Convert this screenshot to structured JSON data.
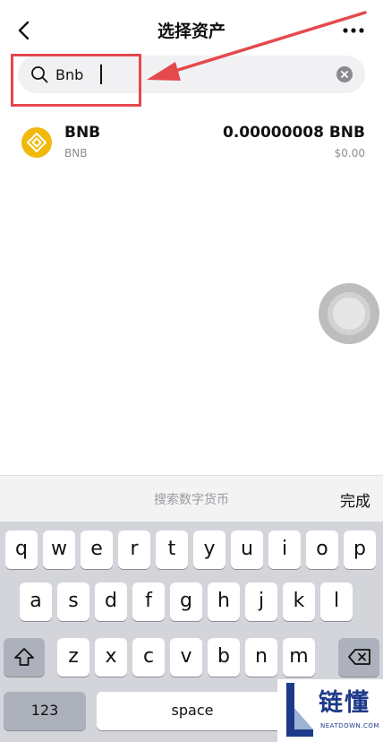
{
  "header": {
    "title": "选择资产",
    "back_icon": "chevron-left-icon",
    "more_icon": "more-horizontal-icon"
  },
  "search": {
    "value": "Bnb",
    "icon": "search-icon",
    "clear_icon": "clear-icon"
  },
  "annotation": {
    "color": "#e5484d"
  },
  "assets": [
    {
      "name": "BNB",
      "sub": "BNB",
      "balance": "0.00000008 BNB",
      "value": "$0.00",
      "icon_color": "#f0b90b"
    }
  ],
  "keyboard": {
    "toolbar_placeholder": "搜索数字货币",
    "done_label": "完成",
    "row1": [
      "q",
      "w",
      "e",
      "r",
      "t",
      "y",
      "u",
      "i",
      "o",
      "p"
    ],
    "row2": [
      "a",
      "s",
      "d",
      "f",
      "g",
      "h",
      "j",
      "k",
      "l"
    ],
    "row3": [
      "z",
      "x",
      "c",
      "v",
      "b",
      "n",
      "m"
    ],
    "numbers_label": "123",
    "space_label": "space"
  },
  "watermark": {
    "text": "链懂",
    "sub": "NEATDOWN.COM"
  }
}
